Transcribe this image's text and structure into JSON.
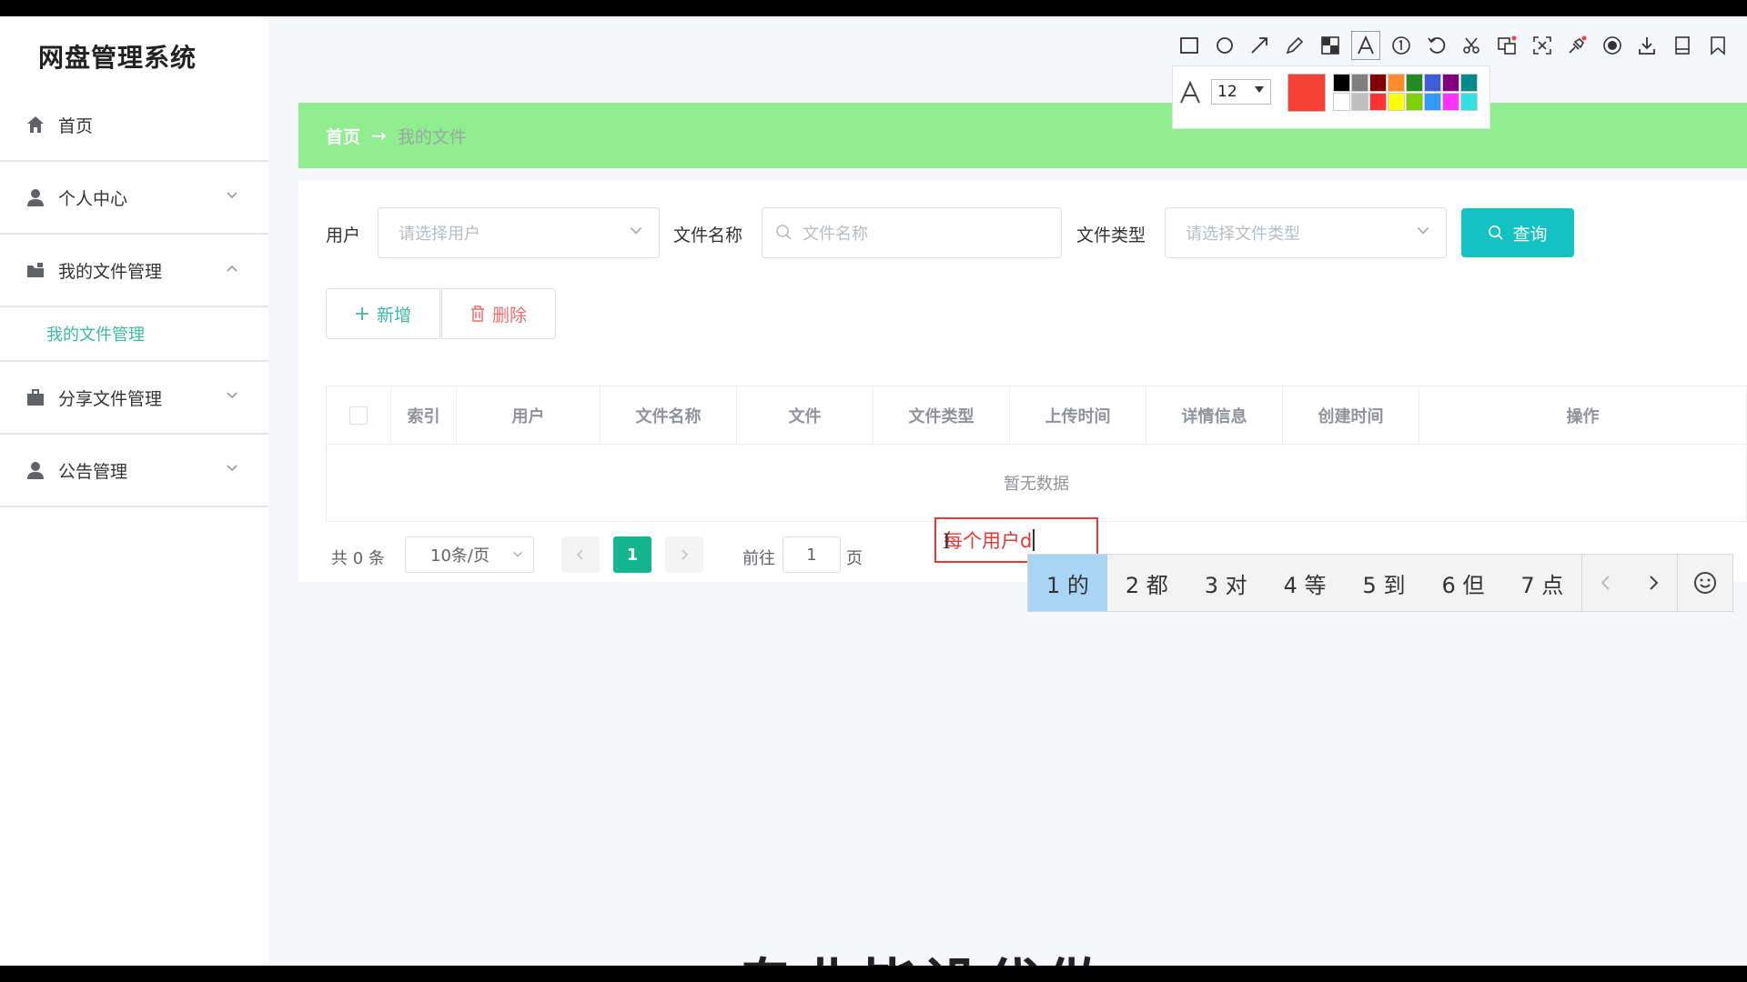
{
  "app": {
    "title": "网盘管理系统"
  },
  "sidebar": {
    "items": [
      {
        "label": "首页",
        "icon": "home-icon"
      },
      {
        "label": "个人中心",
        "icon": "user-icon"
      },
      {
        "label": "我的文件管理",
        "icon": "folder-icon",
        "expanded": true
      },
      {
        "label": "我的文件管理"
      },
      {
        "label": "分享文件管理",
        "icon": "briefcase-icon"
      },
      {
        "label": "公告管理",
        "icon": "user-icon"
      }
    ]
  },
  "breadcrumb": {
    "home": "首页",
    "arrow": "→",
    "current": "我的文件"
  },
  "search": {
    "user_label": "用户",
    "user_placeholder": "请选择用户",
    "filename_label": "文件名称",
    "filename_placeholder": "文件名称",
    "filetype_label": "文件类型",
    "filetype_placeholder": "请选择文件类型",
    "query_label": "查询"
  },
  "actions": {
    "add_label": "新增",
    "delete_label": "删除"
  },
  "table": {
    "columns": [
      "索引",
      "用户",
      "文件名称",
      "文件",
      "文件类型",
      "上传时间",
      "详情信息",
      "创建时间",
      "操作"
    ],
    "empty_text": "暂无数据"
  },
  "pagination": {
    "total": "共 0 条",
    "page_size": "10条/页",
    "current_page": "1",
    "goto_label": "前往",
    "goto_value": "1",
    "page_suffix": "页"
  },
  "annotation": {
    "text": "每个用户d"
  },
  "ime": {
    "candidates": [
      "1 的",
      "2 都",
      "3 对",
      "4 等",
      "5 到",
      "6 但",
      "7 点"
    ]
  },
  "toolbar": {
    "icons": [
      "rectangle-icon",
      "circle-icon",
      "arrow-icon",
      "pencil-icon",
      "mosaic-icon",
      "text-icon",
      "number-icon",
      "undo-icon",
      "cut-icon",
      "translate-icon",
      "ocr-icon",
      "pin-icon",
      "record-icon",
      "download-icon",
      "save-icon",
      "bookmark-icon"
    ],
    "font_size": "12",
    "active_color": "#f44336",
    "palette": [
      "#000000",
      "#808080",
      "#800000",
      "#ff8c2a",
      "#228b22",
      "#3a5fd9",
      "#800080",
      "#008b8b",
      "#ffffff",
      "#c0c0c0",
      "#ff3333",
      "#ffff00",
      "#7fd000",
      "#3399ff",
      "#ff33ff",
      "#33e0e0"
    ]
  },
  "subtitle": {
    "text": "专业毕设代做"
  },
  "colors": {
    "accent": "#13c2c2",
    "breadcrumb_bg": "#90ee90",
    "active_menu": "#3cb9a0",
    "danger": "#f56c6c"
  }
}
